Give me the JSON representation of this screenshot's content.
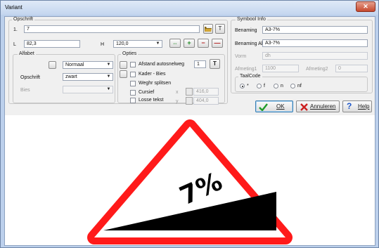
{
  "window": {
    "title": "Variant",
    "close_glyph": "✕"
  },
  "opschrift": {
    "legend": "Opschrift",
    "row1_label": "1.",
    "row1_value": "7",
    "t_button": "T",
    "l_label": "L",
    "l_value": "82,3",
    "h_label": "H",
    "h_value": "120,0",
    "arrows_glyph": "⇔",
    "plus_glyph": "+",
    "minus_glyph": "−",
    "dash_glyph": "—"
  },
  "alfabet": {
    "legend": "Alfabet",
    "font_value": "Normaal",
    "opschrift_label": "Opschrift",
    "opschrift_value": "zwart",
    "bies_label": "Bies",
    "bies_value": ""
  },
  "opties": {
    "legend": "Opties",
    "afstand_label": "Afstand autosnelweg",
    "afstand_value": "1",
    "t_glyph": "T",
    "kader_label": "Kader - Bies",
    "weghr_label": "Weghr splitsen",
    "cursief_label": "Cursief",
    "x_label": "x",
    "x_value": "416,0",
    "losse_label": "Losse tekst",
    "y_label": "y",
    "y_value": "404,0"
  },
  "symbool": {
    "legend": "Symbool Info",
    "benaming_label": "Benaming",
    "benaming_value": "A3-7%",
    "benaming_alt_label": "Benaming Alt",
    "benaming_alt_value": "A3-7%",
    "vorm_label": "Vorm",
    "vorm_value": "dh",
    "afmeting1_label": "Afmeting1",
    "afmeting1_value": "1100",
    "afmeting2_label": "Afmeting2",
    "afmeting2_value": "0"
  },
  "taalcode": {
    "legend": "TaalCode",
    "options": [
      "*",
      "f",
      "n",
      "nf"
    ],
    "selected": "*"
  },
  "buttons": {
    "ok": "OK",
    "annuleren": "Annuleren",
    "help": "Help"
  },
  "sign": {
    "text": "7%",
    "border_color": "#ff1a1a",
    "fill_color": "#ffffff",
    "slope_color": "#000000"
  },
  "colors": {
    "ok_check": "#1e9b2a",
    "cancel_x": "#cc1f1f",
    "help_q": "#1e57c9"
  }
}
